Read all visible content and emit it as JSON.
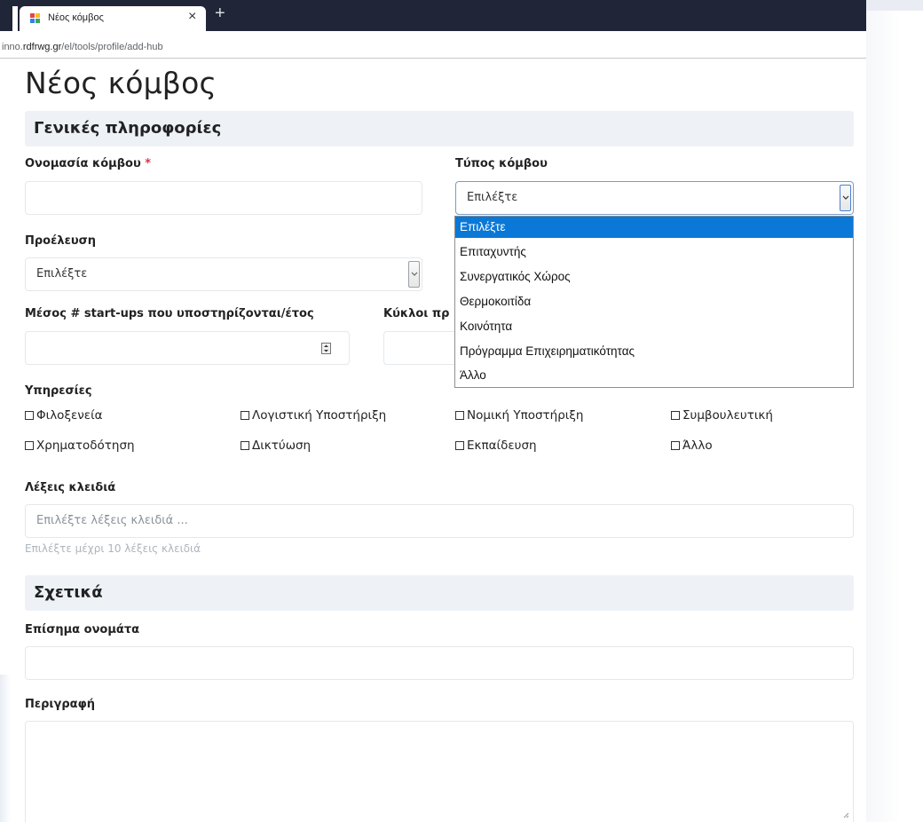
{
  "browser": {
    "tab_title": "Νέος κόμβος",
    "tab_close": "×",
    "new_tab": "+",
    "url_prefix": "inno.",
    "url_host": "rdfrwg.gr",
    "url_path": "/el/tools/profile/add-hub"
  },
  "page": {
    "title": "Νέος κόμβος"
  },
  "general": {
    "section_title": "Γενικές πληροφορίες",
    "hub_name_label": "Ονομασία κόμβου",
    "required_mark": "*",
    "hub_type_label": "Τύπος κόμβου",
    "hub_type_value": "Επιλέξτε",
    "origin_label": "Προέλευση",
    "origin_value": "Επιλέξτε",
    "startups_label": "Μέσος # start-ups που υποστηρίζονται/έτος",
    "cycles_label": "Κύκλοι πρ",
    "services_label": "Υπηρεσίες",
    "services": [
      "Φιλοξενεία",
      "Λογιστική Υποστήριξη",
      "Νομική Υποστήριξη",
      "Συμβουλευτική",
      "Χρηματοδότηση",
      "Δικτύωση",
      "Εκπαίδευση",
      "Άλλο"
    ],
    "keywords_label": "Λέξεις κλειδιά",
    "keywords_placeholder": "Επιλέξτε λέξεις κλειδιά ...",
    "keywords_hint": "Επιλέξτε μέχρι 10 λέξεις κλειδιά"
  },
  "dropdown": {
    "options": [
      "Επιλέξτε",
      "Επιταχυντής",
      "Συνεργατικός Χώρος",
      "Θερμοκοιτίδα",
      "Κοινότητα",
      "Πρόγραμμα Επιχειρηματικότητας",
      "Άλλο"
    ],
    "selected": "Επιλέξτε"
  },
  "about": {
    "section_title": "Σχετικά",
    "official_names_label": "Επίσημα ονομάτα",
    "description_label": "Περιγραφή"
  },
  "colors": {
    "tabbar": "#202538",
    "section_bg": "#eef2f7",
    "selected_option": "#0a78d7",
    "required": "#dc3545"
  }
}
